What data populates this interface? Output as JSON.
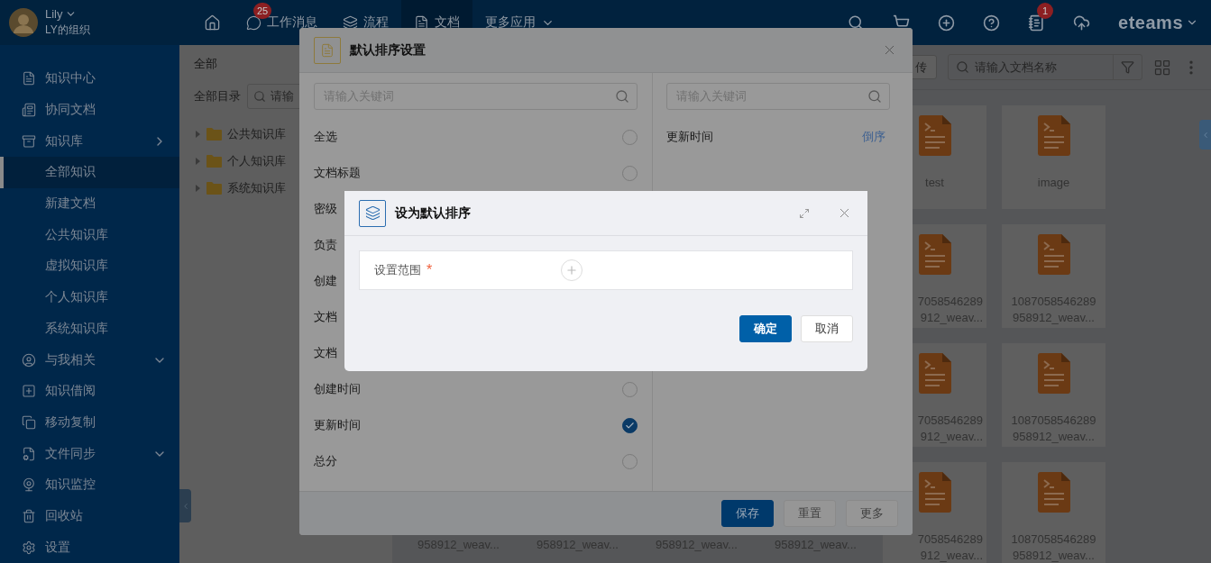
{
  "topbar": {
    "user_name": "Lily",
    "org": "LY的组织",
    "nav": [
      {
        "label": "工作消息",
        "badge": "25",
        "selected": false
      },
      {
        "label": "流程",
        "selected": false
      },
      {
        "label": "文档",
        "selected": true
      },
      {
        "label": "更多应用",
        "selected": false
      }
    ],
    "notice_badge": "1",
    "logo": "eteams"
  },
  "sidebar": {
    "items": [
      {
        "label": "知识中心",
        "selected": false
      },
      {
        "label": "协同文档",
        "selected": false
      },
      {
        "label": "知识库",
        "selected": false,
        "expanded": true,
        "children": [
          {
            "label": "全部知识",
            "selected": true
          },
          {
            "label": "新建文档",
            "selected": false
          },
          {
            "label": "公共知识库",
            "selected": false
          },
          {
            "label": "虚拟知识库",
            "selected": false
          },
          {
            "label": "个人知识库",
            "selected": false
          },
          {
            "label": "系统知识库",
            "selected": false
          }
        ]
      },
      {
        "label": "与我相关",
        "selected": false,
        "expanded": false
      },
      {
        "label": "知识借阅",
        "selected": false
      },
      {
        "label": "移动复制",
        "selected": false
      },
      {
        "label": "文件同步",
        "selected": false,
        "expanded": false
      },
      {
        "label": "知识监控",
        "selected": false
      },
      {
        "label": "回收站",
        "selected": false
      },
      {
        "label": "设置",
        "selected": false
      }
    ]
  },
  "tree_panel": {
    "title": "全部",
    "dir_label": "全部目录",
    "search_placeholder": "请输",
    "tree": [
      {
        "label": "公共知识库",
        "expanded": false
      },
      {
        "label": "个人知识库",
        "expanded": false
      },
      {
        "label": "系统知识库",
        "expanded": false
      }
    ]
  },
  "content": {
    "upload_label": "传",
    "search_placeholder": "请输入文档名称",
    "file_rows": [
      [
        {
          "kind": "file",
          "lines": [
            "test"
          ]
        },
        {
          "kind": "file",
          "lines": [
            "image"
          ]
        }
      ],
      [
        {
          "kind": "clipped",
          "lines": [
            "7058546289",
            "912_weav..."
          ]
        },
        {
          "kind": "file",
          "lines": [
            "1087058546289",
            "958912_weav..."
          ]
        }
      ],
      [
        {
          "kind": "clipped",
          "lines": [
            "7058546289",
            "912_weav..."
          ]
        },
        {
          "kind": "file",
          "lines": [
            "1087058546289",
            "958912_weav..."
          ]
        }
      ],
      [
        {
          "kind": "tail",
          "lines": [
            "958912_weav..."
          ]
        },
        {
          "kind": "tail",
          "lines": [
            "958912_weav..."
          ]
        },
        {
          "kind": "tail",
          "lines": [
            "958912_weav..."
          ]
        },
        {
          "kind": "tail",
          "lines": [
            "958912_weav..."
          ]
        },
        {
          "kind": "clipped",
          "lines": [
            "7058546289",
            "912_weav..."
          ]
        },
        {
          "kind": "file",
          "lines": [
            "1087058546289",
            "958912_weav..."
          ]
        }
      ]
    ]
  },
  "sort_dialog": {
    "title": "默认排序设置",
    "search_placeholder": "请输入关键词",
    "fields": [
      {
        "label": "全选",
        "checked": false
      },
      {
        "label": "文档标题",
        "checked": false
      },
      {
        "label": "密级"
      },
      {
        "label": "负责"
      },
      {
        "label": "创建"
      },
      {
        "label": "文档"
      },
      {
        "label": "文档"
      },
      {
        "label": "创建时间",
        "checked": false
      },
      {
        "label": "更新时间",
        "checked": true
      },
      {
        "label": "总分",
        "checked": false
      }
    ],
    "sort_search_placeholder": "请输入关键词",
    "sort_items": [
      {
        "label": "更新时间",
        "order": "倒序"
      }
    ],
    "buttons": [
      {
        "label": "保存",
        "primary": true
      },
      {
        "label": "重置",
        "primary": false
      },
      {
        "label": "更多",
        "primary": false
      }
    ]
  },
  "default_dialog": {
    "title": "设为默认排序",
    "field_label": "设置范围",
    "required_mark": "*",
    "buttons": [
      {
        "label": "确定",
        "primary": true
      },
      {
        "label": "取消",
        "primary": false
      }
    ]
  }
}
